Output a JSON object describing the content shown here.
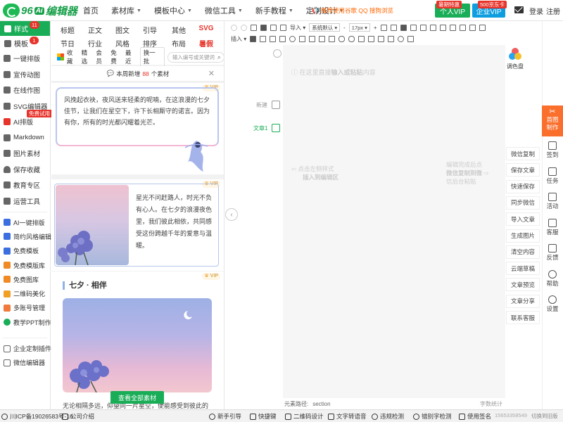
{
  "brand": {
    "num": "96",
    "ai": "Ai",
    "name": "编辑器"
  },
  "nav": [
    {
      "label": "首页",
      "caret": false
    },
    {
      "label": "素材库",
      "caret": true
    },
    {
      "label": "模板中心",
      "caret": true
    },
    {
      "label": "微信工具",
      "caret": true
    },
    {
      "label": "新手教程",
      "caret": true
    },
    {
      "label": "定制设计",
      "caret": true
    }
  ],
  "promo": "推荐使用谷歌 QQ 搜狗浏览",
  "vip_button": {
    "label": "个人VIP",
    "tag": "暑期特惠"
  },
  "enterprise_button": {
    "label": "企业VIP",
    "tag": "500京东卡"
  },
  "auth": {
    "login": "登录",
    "register": "注册"
  },
  "sidebar": {
    "style": {
      "label": "样式",
      "badge": "11"
    },
    "template": {
      "label": "模板",
      "badge": "1"
    },
    "items": [
      {
        "label": "一键排版"
      },
      {
        "label": "宣传动图"
      },
      {
        "label": "在线作图"
      },
      {
        "label": "SVG编辑器"
      },
      {
        "label": "AI排版",
        "badge": "免费试用"
      },
      {
        "label": "Markdown"
      },
      {
        "label": "图片素材"
      },
      {
        "label": "保存收藏"
      },
      {
        "label": "教育专区"
      },
      {
        "label": "运营工具"
      }
    ],
    "tools": [
      {
        "label": "AI一键排版",
        "color": "#3b6fe0"
      },
      {
        "label": "简约风格编辑",
        "color": "#3b6fe0"
      },
      {
        "label": "免费模板",
        "color": "#3b6fe0"
      },
      {
        "label": "免费模版库",
        "color": "#f08a24"
      },
      {
        "label": "免费图库",
        "color": "#f08a24"
      },
      {
        "label": "二维码美化",
        "color": "#f0a024"
      },
      {
        "label": "多账号管理",
        "color": "#ef7a3c"
      },
      {
        "label": "教学PPT制作",
        "color": "#1aad57"
      }
    ],
    "extra": [
      {
        "label": "企业定制插件"
      },
      {
        "label": "微信编辑器"
      }
    ]
  },
  "categories": {
    "row1": [
      "标题",
      "正文",
      "图文",
      "引导",
      "其他",
      "SVG"
    ],
    "row2": [
      "节日",
      "行业",
      "风格",
      "排序",
      "布局",
      "暑假"
    ]
  },
  "filters": {
    "options": [
      "收藏",
      "精选",
      "会员",
      "免费",
      "最近"
    ],
    "swap": "换一批",
    "search_placeholder": "输入编号或关键词"
  },
  "notice": {
    "prefix": "本周新增",
    "count": "88",
    "suffix": "个素材"
  },
  "cards": [
    {
      "vip": "VIP",
      "text": "风挽起衣袂，夜风送来轻柔的呢喃，在这浪漫的七夕佳节，让我们在星空下，许下长相厮守的诺言。因为有你，所有的时光都闪耀着光芒。"
    },
    {
      "vip": "VIP",
      "text": "星光不问赶路人，时光不负有心人。在七夕的浪漫夜色里，我们彼此相依，共同感受这份跨越千年的爱意与温暖。"
    },
    {
      "vip": "VIP",
      "title": "七夕 · 相伴",
      "text": "无论相隔多远，仰望同一片星空，便能感受到彼此的"
    }
  ],
  "view_all": "查看全部素材",
  "gutter": {
    "new": "新建",
    "doc": "文章1"
  },
  "toolbar": {
    "import": "导入",
    "font": "系统默认",
    "size": "17px",
    "insert": "插入"
  },
  "canvas": {
    "placeholder_prefix": "在这里直接",
    "placeholder_bold": "输入或粘贴",
    "placeholder_suffix": "内容",
    "left_hint_1": "点击左侧样式",
    "left_hint_2": "插入到编辑区",
    "right_hint_1": "编辑完成后点",
    "right_hint_2": "微信复制到微",
    "right_hint_3": "信后台粘贴"
  },
  "status": {
    "path_label": "元素路径:",
    "path_value": "section",
    "count_label": "字数统计"
  },
  "palette_label": "调色盘",
  "actions": [
    "微信复制",
    "保存文章",
    "快速保存",
    "同步微信",
    "导入文章",
    "生成图片",
    "清空内容",
    "云端草稿",
    "文章预览",
    "文章分享",
    "联系客服"
  ],
  "far_right": {
    "home": "首图制作",
    "items": [
      "签到",
      "任务",
      "活动",
      "客服",
      "反馈",
      "帮助",
      "设置"
    ]
  },
  "bottom": {
    "icp": "川ICP备19026583号-16",
    "company": "公司介绍",
    "links": [
      "新手引导",
      "快捷键",
      "二维码设计",
      "文字转语音",
      "违规检测",
      "错别字检测",
      "使用签名"
    ],
    "phone": "15653358549",
    "switch": "切换到旧版"
  },
  "colors": {
    "green": "#1aad57",
    "blue": "#0e9ee0",
    "red": "#e7342b",
    "orange": "#fb6f2d"
  }
}
